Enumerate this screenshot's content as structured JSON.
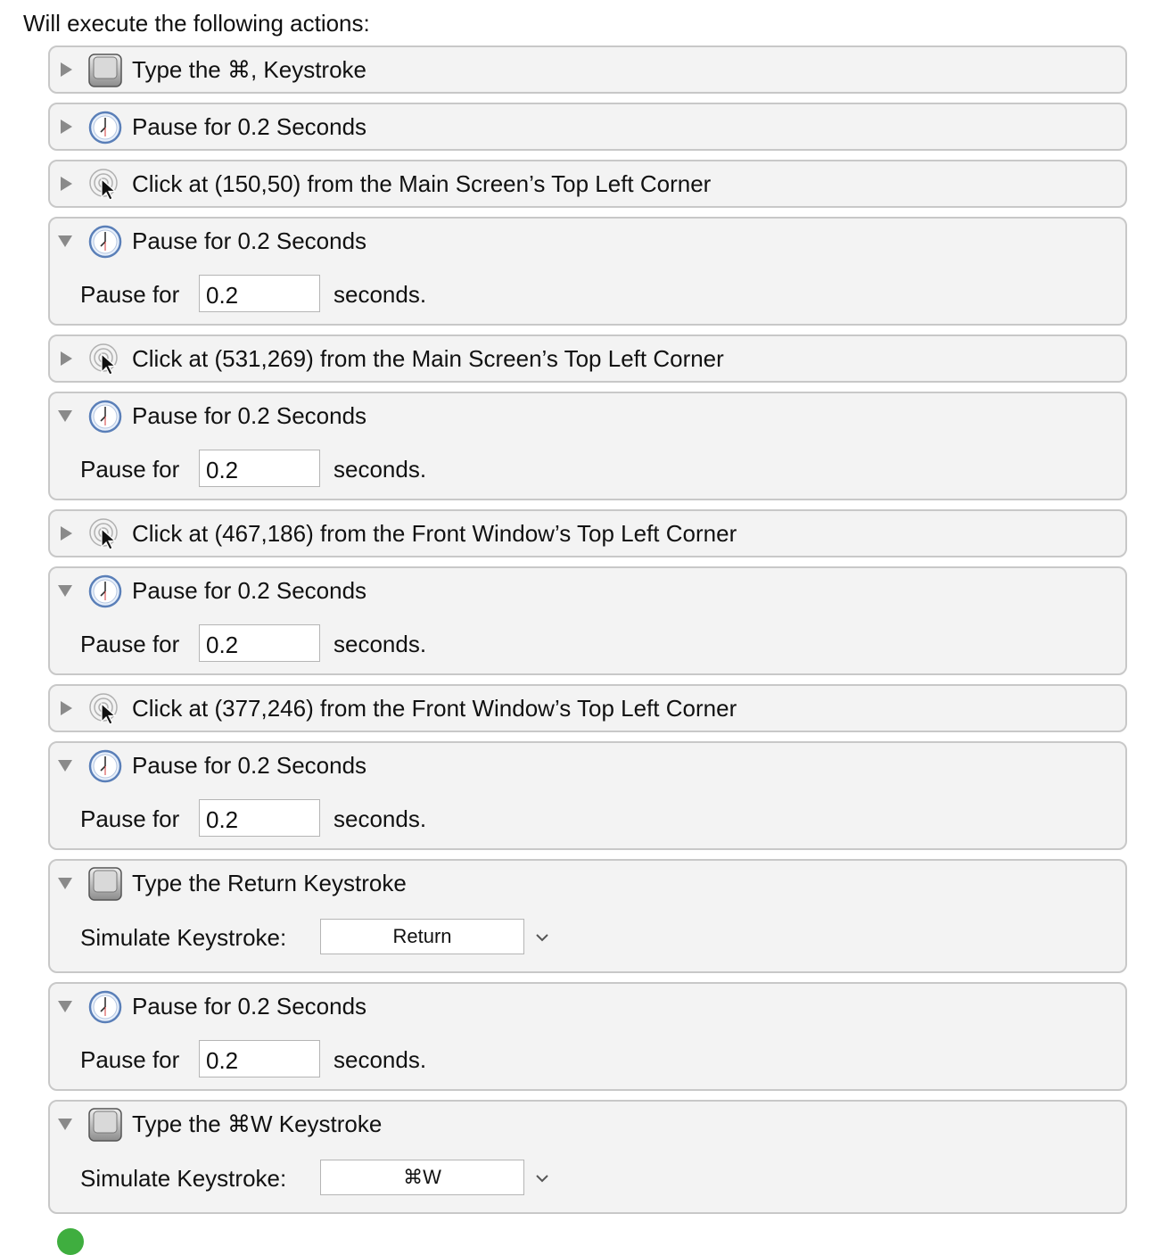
{
  "header": "Will execute the following actions:",
  "actions": [
    {
      "type": "keystroke",
      "expanded": false,
      "title": "Type the ⌘, Keystroke"
    },
    {
      "type": "pause",
      "expanded": false,
      "title": "Pause for 0.2 Seconds"
    },
    {
      "type": "click",
      "expanded": false,
      "title": "Click at (150,50) from the Main Screen’s Top Left Corner"
    },
    {
      "type": "pause",
      "expanded": true,
      "title": "Pause for 0.2 Seconds",
      "label": "Pause for",
      "value": "0.2",
      "unit": "seconds."
    },
    {
      "type": "click",
      "expanded": false,
      "title": "Click at (531,269) from the Main Screen’s Top Left Corner"
    },
    {
      "type": "pause",
      "expanded": true,
      "title": "Pause for 0.2 Seconds",
      "label": "Pause for",
      "value": "0.2",
      "unit": "seconds."
    },
    {
      "type": "click",
      "expanded": false,
      "title": "Click at (467,186) from the Front Window’s Top Left Corner"
    },
    {
      "type": "pause",
      "expanded": true,
      "title": "Pause for 0.2 Seconds",
      "label": "Pause for",
      "value": "0.2",
      "unit": "seconds."
    },
    {
      "type": "click",
      "expanded": false,
      "title": "Click at (377,246) from the Front Window’s Top Left Corner"
    },
    {
      "type": "pause",
      "expanded": true,
      "title": "Pause for 0.2 Seconds",
      "label": "Pause for",
      "value": "0.2",
      "unit": "seconds."
    },
    {
      "type": "keystroke",
      "expanded": true,
      "title": "Type the Return Keystroke",
      "label": "Simulate Keystroke:",
      "value": "Return"
    },
    {
      "type": "pause",
      "expanded": true,
      "title": "Pause for 0.2 Seconds",
      "label": "Pause for",
      "value": "0.2",
      "unit": "seconds."
    },
    {
      "type": "keystroke",
      "expanded": true,
      "title": "Type the ⌘W Keystroke",
      "label": "Simulate Keystroke:",
      "value": "⌘W"
    }
  ],
  "colors": {
    "action_bg": "#f3f3f3",
    "action_border": "#c8c8c8",
    "triangle": "#8a8a8a",
    "status_dot": "#3fae3f"
  },
  "icons": {
    "keystroke": "keyboard-key-icon",
    "pause": "clock-icon",
    "click": "mouse-click-icon"
  }
}
